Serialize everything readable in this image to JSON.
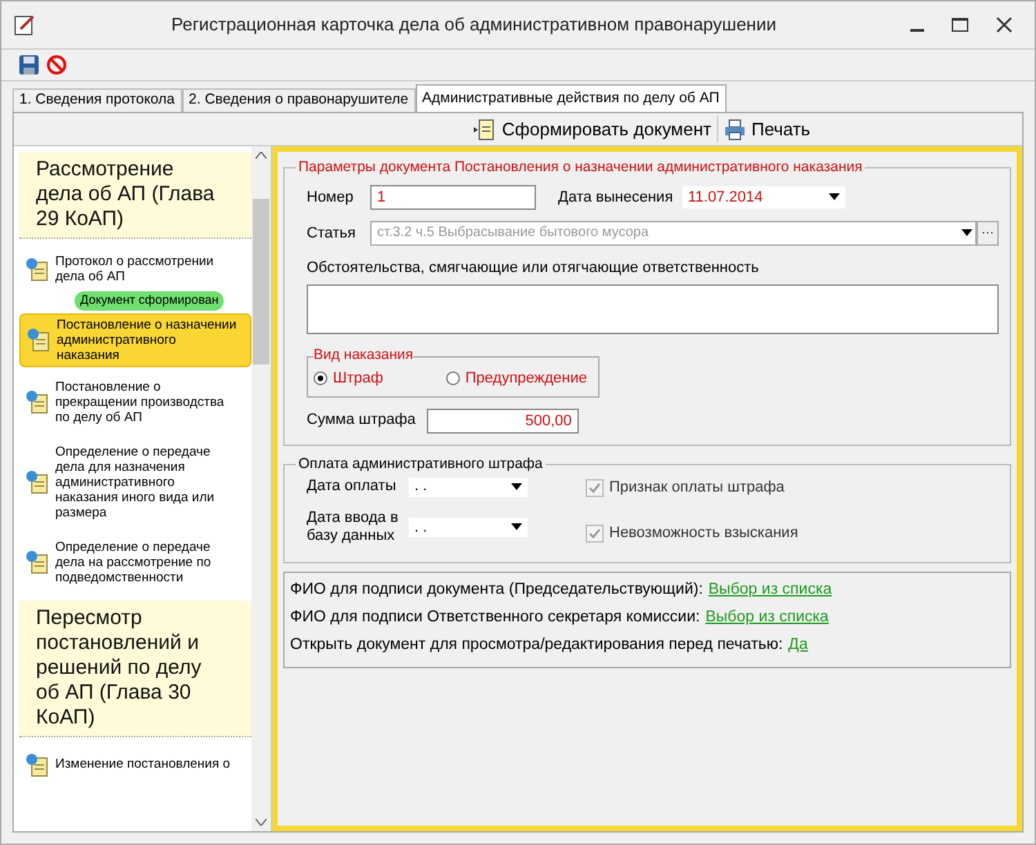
{
  "window": {
    "title": "Регистрационная карточка дела об административном правонарушении"
  },
  "tabs": [
    {
      "label": "1. Сведения протокола",
      "selected": false
    },
    {
      "label": "2. Сведения о правонарушителе",
      "selected": false
    },
    {
      "label": "Административные действия по делу об АП",
      "selected": true
    }
  ],
  "doc_toolbar": {
    "generate": "Сформировать документ",
    "print": "Печать"
  },
  "sidebar": {
    "items": [
      {
        "kind": "header",
        "label": "Рассмотрение дела об АП  (Глава 29 КоАП)"
      },
      {
        "kind": "doc",
        "label": "Протокол о рассмотрении дела об АП",
        "selected": false,
        "badge": "Документ сформирован"
      },
      {
        "kind": "doc",
        "label": "Постановление о назначении административного наказания",
        "selected": true
      },
      {
        "kind": "doc",
        "label": "Постановление о прекращении производства по делу об АП",
        "selected": false
      },
      {
        "kind": "doc",
        "label": "Определение о передаче дела для назначения административного наказания  иного вида или размера",
        "selected": false
      },
      {
        "kind": "doc",
        "label": "Определение о передаче дела на рассмотрение по подведомственности",
        "selected": false
      },
      {
        "kind": "header",
        "label": "Пересмотр постановлений и решений по делу об АП (Глава 30 КоАП)"
      },
      {
        "kind": "doc",
        "label": "Изменение постановления о",
        "selected": false
      }
    ]
  },
  "params": {
    "title": "Параметры документа Постановления о назначении административного наказания",
    "number_label": "Номер",
    "number": "1",
    "date_label": "Дата вынесения",
    "date": "11.07.2014",
    "article_label": "Статья",
    "article": "ст.3.2 ч.5 Выбрасывание бытового мусора",
    "article_button": "···",
    "circumstances_label": "Обстоятельства, смягчающие или отягчающие ответственность",
    "penalty_title": "Вид наказания",
    "penalty_options": [
      {
        "label": "Штраф",
        "selected": true
      },
      {
        "label": "Предупреждение",
        "selected": false
      }
    ],
    "fine_label": "Сумма штрафа",
    "fine": "500,00"
  },
  "payment": {
    "title": "Оплата административного штрафа",
    "pay_date_label": "Дата оплаты",
    "pay_date": ". .",
    "entry_date_label": "Дата ввода в базу данных",
    "entry_date": ". .",
    "checks": [
      {
        "label": "Признак оплаты штрафа",
        "checked": true,
        "disabled": true
      },
      {
        "label": "Невозможность взыскания",
        "checked": true,
        "disabled": true
      }
    ]
  },
  "signatures": [
    {
      "label": "ФИО для подписи документа (Председательствующий):",
      "link": "Выбор из списка"
    },
    {
      "label": "ФИО для подписи Ответственного секретаря комиссии:",
      "link": "Выбор из списка"
    },
    {
      "label": "Открыть документ для просмотра/редактирования перед печатью:",
      "link": "Да"
    }
  ]
}
